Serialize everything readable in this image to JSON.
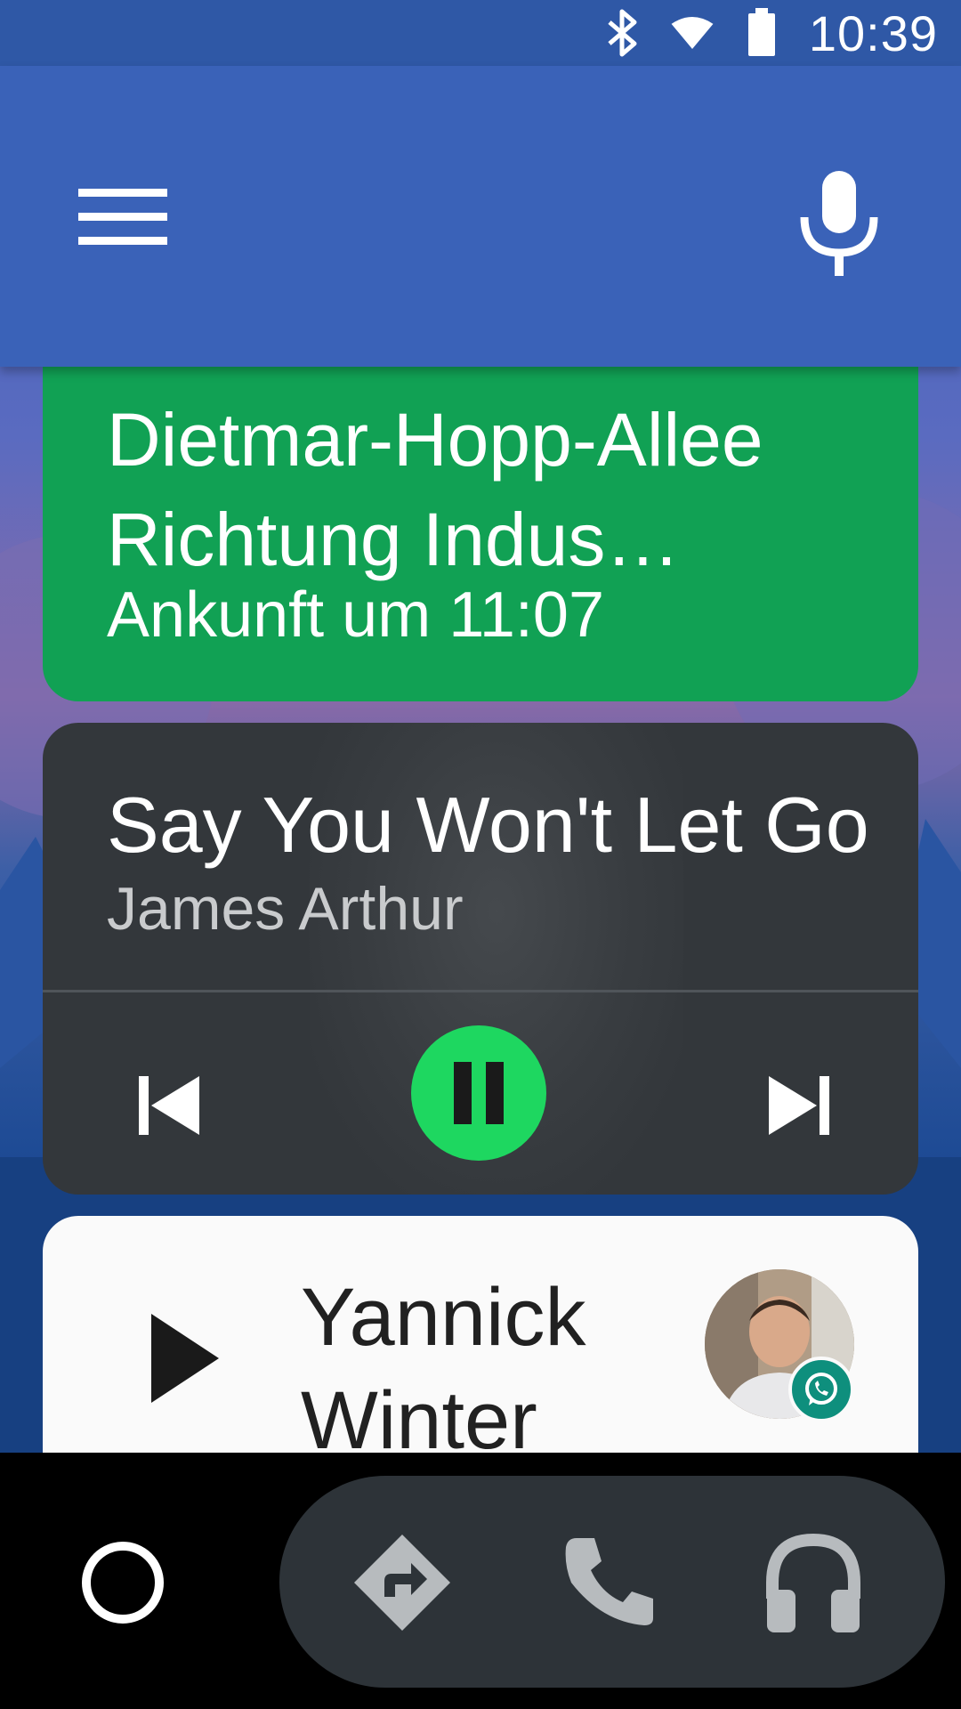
{
  "status_bar": {
    "time": "10:39",
    "icons": [
      "bluetooth-icon",
      "wifi-icon",
      "battery-icon"
    ]
  },
  "app_bar": {
    "menu_icon": "menu-icon",
    "voice_icon": "mic-icon"
  },
  "navigation_card": {
    "destination": "Dietmar-Hopp-Allee Richtung Indus…",
    "arrival": "Ankunft um 11:07",
    "color": "#11a154"
  },
  "media_card": {
    "title": "Say You Won't Let Go",
    "artist": "James Arthur",
    "state": "playing",
    "accent": "#1ed760"
  },
  "message_card": {
    "contact": "Yannick Winter",
    "app_badge": "whatsapp-icon"
  },
  "bottom_nav": {
    "items": [
      "home-icon",
      "navigation-icon",
      "phone-icon",
      "headphones-icon"
    ]
  }
}
